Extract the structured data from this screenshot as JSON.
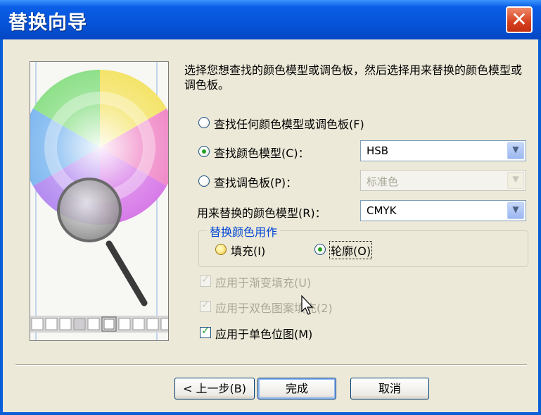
{
  "window": {
    "title": "替换向导",
    "close_icon": "close-icon"
  },
  "preview": {
    "image": "color-wheel-magnifier-illustration"
  },
  "instructions": "选择您想查找的颜色模型或调色板，然后选择用来替换的颜色模型或调色板。",
  "find_options": [
    {
      "label": "查找任何颜色模型或调色板(F)",
      "checked": false
    },
    {
      "label": "查找颜色模型(C)：",
      "checked": true,
      "combo_value": "HSB",
      "combo_enabled": true
    },
    {
      "label": "查找调色板(P)：",
      "checked": false,
      "combo_value": "标准色",
      "combo_enabled": false
    }
  ],
  "replace": {
    "label": "用来替换的颜色模型(R)：",
    "combo_value": "CMYK"
  },
  "replace_group": {
    "title": "替换颜色用作",
    "fill_label": "填充(I)",
    "fill_checked": false,
    "outline_label": "轮廓(O)",
    "outline_checked": true
  },
  "checkboxes": [
    {
      "label": "应用于渐变填充(U)",
      "checked": true,
      "enabled": false
    },
    {
      "label": "应用于双色图案填充(2)",
      "checked": true,
      "enabled": false
    },
    {
      "label": "应用于单色位图(M)",
      "checked": true,
      "enabled": true
    }
  ],
  "buttons": {
    "back": "< 上一步(B)",
    "finish": "完成",
    "cancel": "取消"
  },
  "colors": {
    "title_bar": "#0a5ed8",
    "dialog_bg": "#ece9d8",
    "group_title": "#0046d5",
    "check_green": "#21a121"
  }
}
